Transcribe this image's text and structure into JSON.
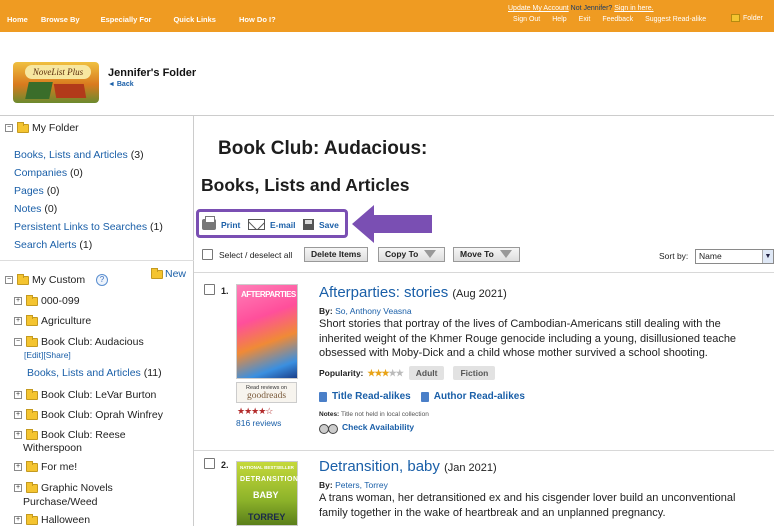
{
  "topnav": {
    "items": [
      "Home",
      "Browse By",
      "Especially For",
      "Quick Links",
      "How Do I?"
    ],
    "account_link": "Update My Account",
    "not_user": "Not Jennifer?",
    "sign_in": "Sign in here.",
    "links": [
      "Sign Out",
      "Help",
      "Exit",
      "Feedback",
      "Suggest Read-alike"
    ],
    "folder": "Folder"
  },
  "header": {
    "logo_text": "NoveList Plus",
    "title": "Jennifer's Folder",
    "back": "Back"
  },
  "sidebar": {
    "my_folder": "My Folder",
    "folder_links": [
      {
        "label": "Books, Lists and Articles",
        "count": "(3)"
      },
      {
        "label": "Companies",
        "count": "(0)"
      },
      {
        "label": "Pages",
        "count": "(0)"
      },
      {
        "label": "Notes",
        "count": "(0)"
      },
      {
        "label": "Persistent Links to Searches",
        "count": "(1)"
      },
      {
        "label": "Search Alerts",
        "count": "(1)"
      }
    ],
    "my_custom": "My Custom",
    "help": "?",
    "new": "New",
    "custom_folders": [
      "000-099",
      "Agriculture",
      "Book Club: Audacious"
    ],
    "edit": "[Edit]",
    "share": "[Share]",
    "sub_link": {
      "label": "Books, Lists and Articles",
      "count": "(11)"
    },
    "more_folders": [
      "Book Club: LeVar Burton",
      "Book Club: Oprah Winfrey",
      "Book Club: Reese",
      "For me!",
      "Graphic Novels",
      "Halloween"
    ],
    "reese_cont": "Witherspoon",
    "graphic_cont": "Purchase/Weed"
  },
  "main": {
    "title1": "Book Club: Audacious:",
    "title2": "Books, Lists and Articles",
    "tools": {
      "print": "Print",
      "email": "E-mail",
      "save": "Save"
    },
    "select_all": "Select / deselect all",
    "delete": "Delete Items",
    "copy": "Copy To",
    "move": "Move To",
    "sort_label": "Sort by:",
    "sort_value": "Name"
  },
  "results": [
    {
      "num": "1.",
      "cover_text": "AFTERPARTIES",
      "title": "Afterparties: stories",
      "date": "(Aug 2021)",
      "by_label": "By:",
      "author": "So, Anthony Veasna",
      "desc": [
        "Short stories that portray of the lives of Cambodian-Americans still dealing with the",
        "inherited weight of the Khmer Rouge genocide including a young, disillusioned teache",
        "obsessed with Moby-Dick and a child whose mother survived a school shooting."
      ],
      "popularity_label": "Popularity:",
      "tags": [
        "Adult",
        "Fiction"
      ],
      "goodreads_line1": "Read reviews on",
      "goodreads_line2": "goodreads",
      "rating_stars": "★★★★☆",
      "reviews": "816 reviews",
      "title_readalikes": "Title Read-alikes",
      "author_readalikes": "Author Read-alikes",
      "notes_label": "Notes:",
      "notes_text": "Title not held in local collection",
      "check": "Check Availability"
    },
    {
      "num": "2.",
      "cover_top": "NATIONAL BESTSELLER",
      "cover_text": "DETRANSITION",
      "cover_text2": "BABY",
      "cover_author": "TORREY",
      "title": "Detransition, baby",
      "date": "(Jan 2021)",
      "by_label": "By:",
      "author": "Peters, Torrey",
      "desc": [
        "A trans woman, her detransitioned ex and his cisgender lover build an unconventional",
        "family together in the wake of heartbreak and an unplanned pregnancy."
      ]
    }
  ],
  "colors": {
    "topbar": "#ef9b22",
    "link": "#1a5fa8",
    "highlight": "#7a4fb3"
  }
}
